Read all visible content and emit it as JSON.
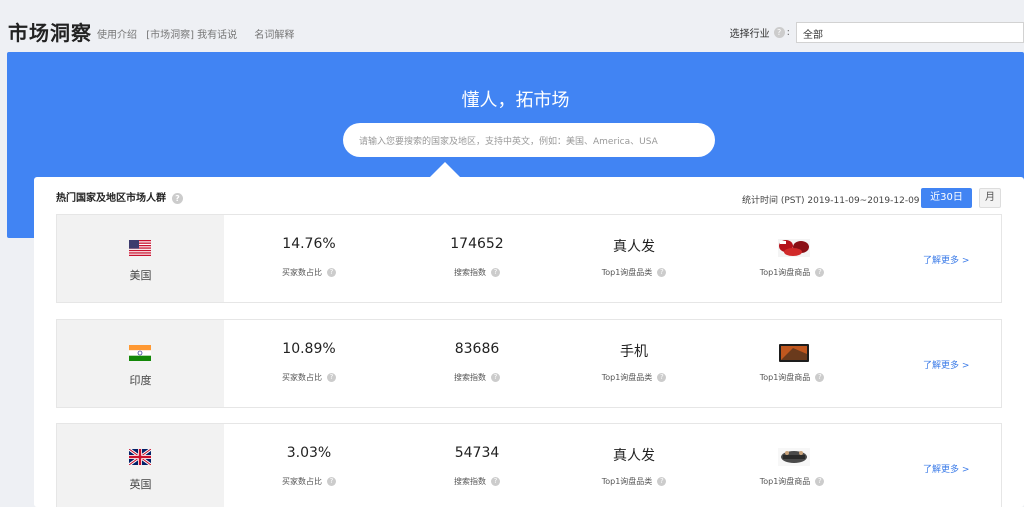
{
  "header": {
    "title": "市场洞察",
    "links": [
      "使用介绍",
      "[市场洞察] 我有话说",
      "名词解释"
    ],
    "industry_label": "选择行业",
    "industry_sep": ":",
    "industry_value": "全部"
  },
  "hero": {
    "title": "懂人，拓市场",
    "search_placeholder": "请输入您要搜索的国家及地区，支持中英文，例如：美国、America、USA"
  },
  "panel": {
    "title": "热门国家及地区市场人群",
    "stat_period": "统计时间 (PST) 2019-11-09~2019-12-09",
    "btn_30": "近30日",
    "btn_month": "月"
  },
  "metric_labels": {
    "buyer_ratio": "买家数占比",
    "search_index": "搜索指数",
    "top_category": "Top1询盘品类",
    "top_product": "Top1询盘商品",
    "more": "了解更多 >"
  },
  "rows": [
    {
      "country": "美国",
      "flag": "us-flag",
      "buyer_ratio": "14.76%",
      "search_index": "174652",
      "top_category": "真人发",
      "product_icon": "hair-product-thumbnail"
    },
    {
      "country": "印度",
      "flag": "india-flag",
      "buyer_ratio": "10.89%",
      "search_index": "83686",
      "top_category": "手机",
      "product_icon": "phone-product-thumbnail"
    },
    {
      "country": "英国",
      "flag": "uk-flag",
      "buyer_ratio": "3.03%",
      "search_index": "54734",
      "top_category": "真人发",
      "product_icon": "wig-product-thumbnail"
    }
  ],
  "colors": {
    "accent": "#4184f3",
    "link": "#3b7be8"
  }
}
